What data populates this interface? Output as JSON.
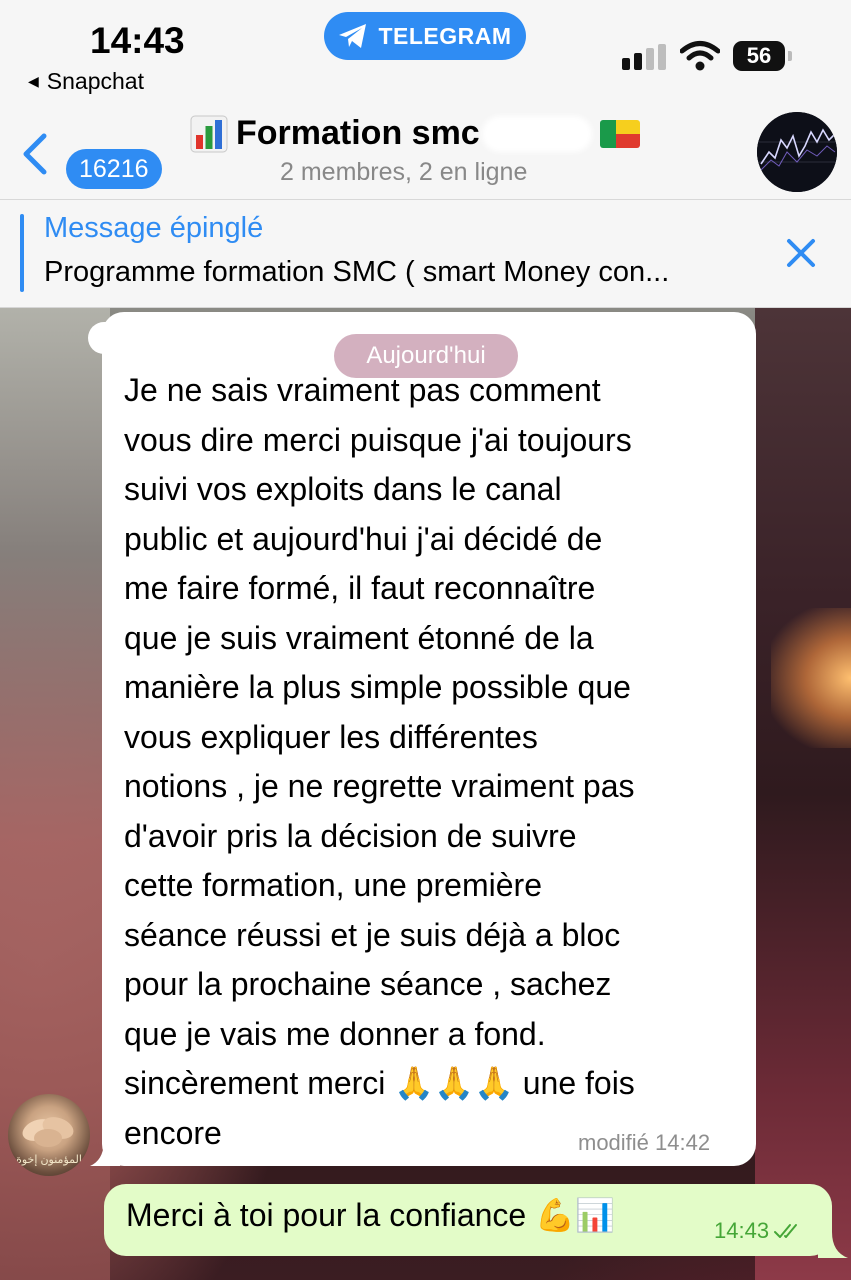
{
  "status_bar": {
    "time": "14:43",
    "back_app": "Snapchat",
    "pill_label": "TELEGRAM",
    "battery": "56"
  },
  "header": {
    "unread_count": "16216",
    "title": "Formation smc",
    "subtitle": "2 membres, 2 en ligne"
  },
  "pinned": {
    "title": "Message épinglé",
    "text": "Programme formation SMC ( smart Money con..."
  },
  "chat": {
    "date_label": "Aujourd'hui",
    "incoming": {
      "lines": [
        "Je ne sais vraiment pas comment",
        "vous dire merci puisque j'ai toujours",
        "suivi vos exploits dans le canal",
        "public et aujourd'hui j'ai décidé de",
        "me faire formé, il faut reconnaître",
        "que je suis vraiment étonné de la",
        "manière la plus simple possible que",
        "vous expliquer les différentes",
        "notions  , je ne regrette vraiment pas",
        "d'avoir pris la décision de suivre",
        "cette formation, une première",
        "séance réussi et je suis déjà a bloc",
        "pour la prochaine séance , sachez",
        "que je vais me donner a fond.",
        "sincèrement merci 🙏🙏🙏 une fois",
        "encore"
      ],
      "meta": "modifié 14:42",
      "avatar_caption": "المؤمنون إخوة"
    },
    "outgoing": {
      "text": "Merci à toi pour la confiance 💪📊",
      "time": "14:43"
    }
  },
  "colors": {
    "accent": "#2f8cf3",
    "outgoing_bubble": "#e3fcc8",
    "outgoing_time": "#45a637"
  }
}
